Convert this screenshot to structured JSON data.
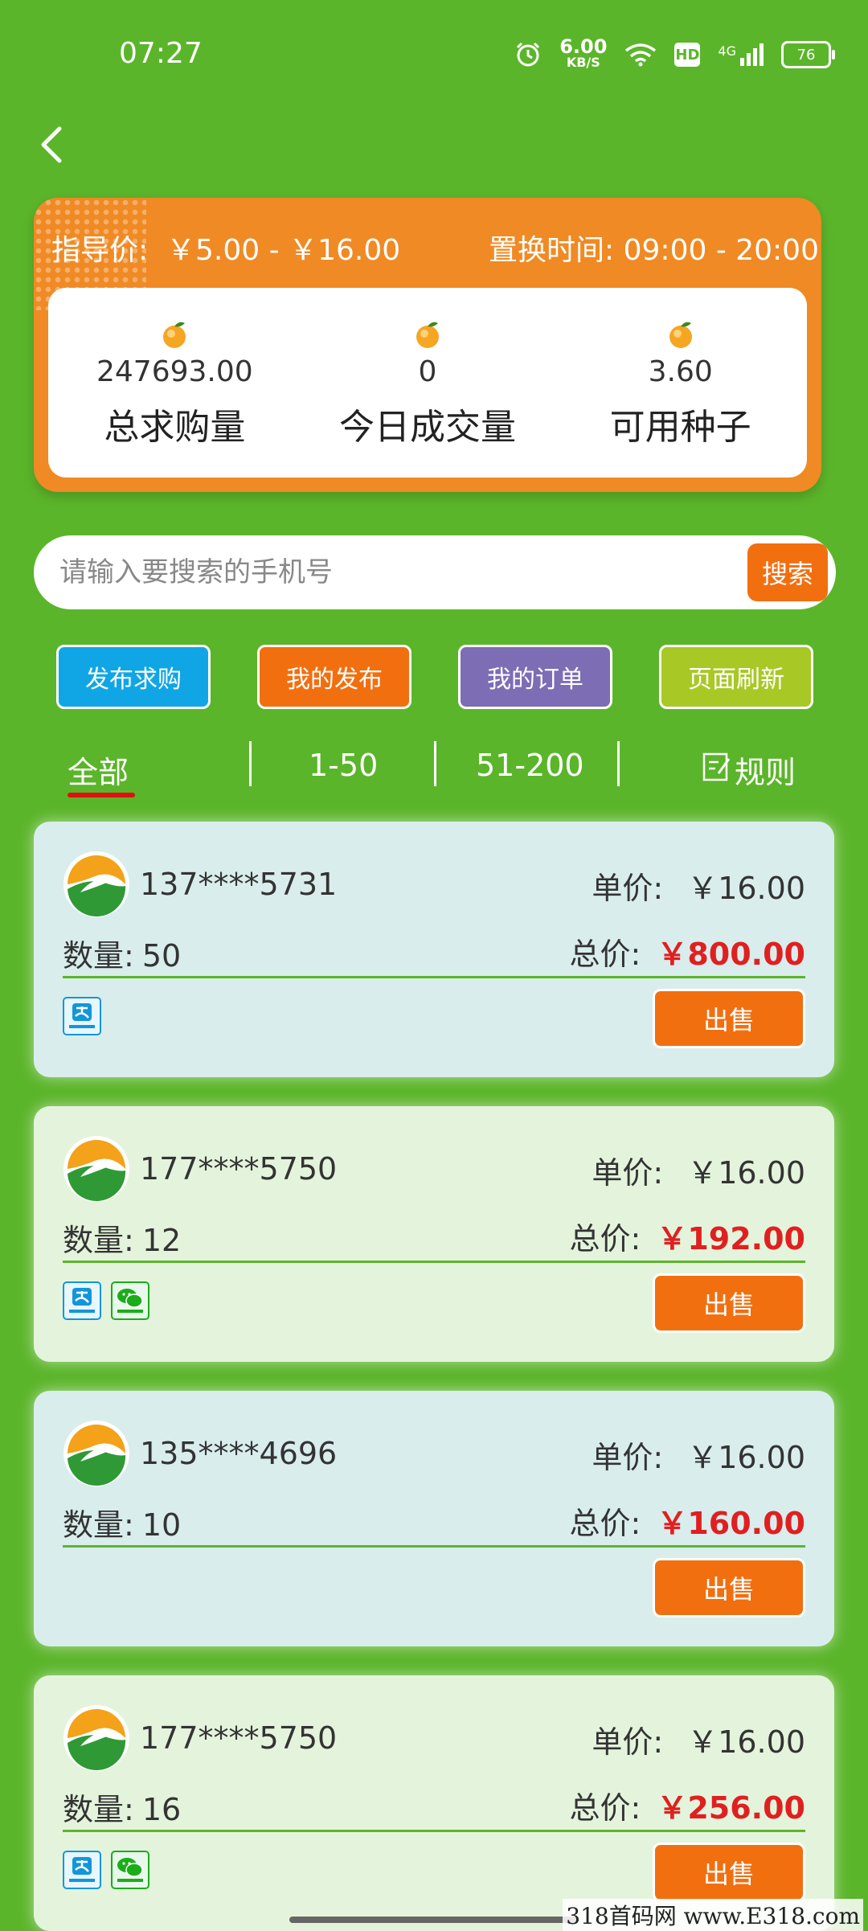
{
  "status_bar": {
    "time": "07:27",
    "speed_value": "6.00",
    "speed_unit": "KB/S",
    "hd": "HD",
    "network": "4G",
    "battery": "76"
  },
  "info": {
    "guide_price_label": "指导价:",
    "guide_price_value": "￥5.00 - ￥16.00",
    "exchange_time_label": "置换时间:",
    "exchange_time_value": "09:00 - 20:00",
    "stats": [
      {
        "value": "247693.00",
        "label": "总求购量"
      },
      {
        "value": "0",
        "label": "今日成交量"
      },
      {
        "value": "3.60",
        "label": "可用种子"
      }
    ]
  },
  "search": {
    "placeholder": "请输入要搜索的手机号",
    "button": "搜索"
  },
  "actions": [
    {
      "label": "发布求购",
      "color": "#10a6e6"
    },
    {
      "label": "我的发布",
      "color": "#f26f10"
    },
    {
      "label": "我的订单",
      "color": "#7c6db5"
    },
    {
      "label": "页面刷新",
      "color": "#a8c826"
    }
  ],
  "tabs": [
    {
      "label": "全部"
    },
    {
      "label": "1-50"
    },
    {
      "label": "51-200"
    },
    {
      "label": "规则"
    }
  ],
  "orders": [
    {
      "phone": "137****5731",
      "unit_price_label": "单价:",
      "unit_price": "￥16.00",
      "qty_label": "数量:",
      "qty": "50",
      "total_label": "总价:",
      "total": "￥800.00",
      "pay": [
        "alipay"
      ],
      "sell": "出售"
    },
    {
      "phone": "177****5750",
      "unit_price_label": "单价:",
      "unit_price": "￥16.00",
      "qty_label": "数量:",
      "qty": "12",
      "total_label": "总价:",
      "total": "￥192.00",
      "pay": [
        "alipay",
        "wechat"
      ],
      "sell": "出售"
    },
    {
      "phone": "135****4696",
      "unit_price_label": "单价:",
      "unit_price": "￥16.00",
      "qty_label": "数量:",
      "qty": "10",
      "total_label": "总价:",
      "total": "￥160.00",
      "pay": [],
      "sell": "出售"
    },
    {
      "phone": "177****5750",
      "unit_price_label": "单价:",
      "unit_price": "￥16.00",
      "qty_label": "数量:",
      "qty": "16",
      "total_label": "总价:",
      "total": "￥256.00",
      "pay": [
        "alipay",
        "wechat"
      ],
      "sell": "出售"
    }
  ],
  "watermark": "318首码网 www.E318.com",
  "colors": {
    "background": "#5bb52a",
    "card_orange": "#f08a24",
    "sell_button": "#f26f10",
    "total_price": "#e02020",
    "card_blue": "#d9eded",
    "card_green": "#e4f4dc"
  }
}
